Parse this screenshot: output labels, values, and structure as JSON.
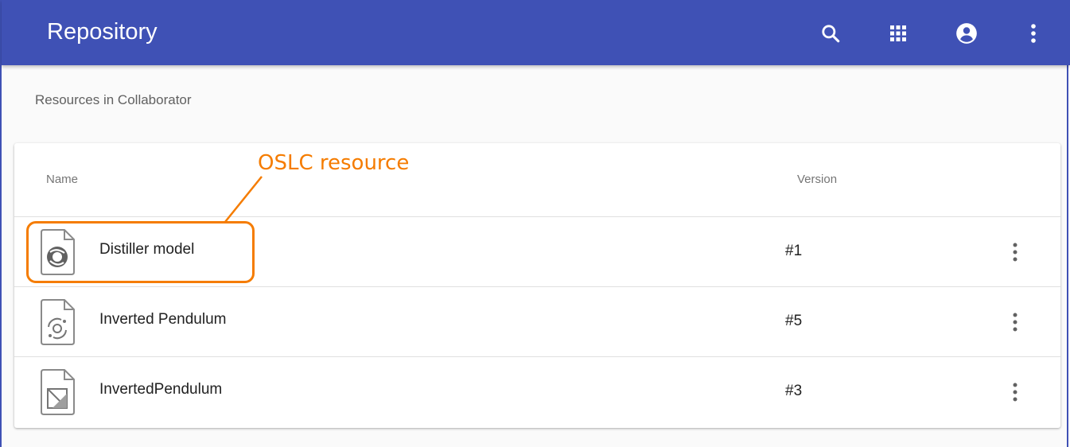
{
  "app": {
    "title": "Repository",
    "colors": {
      "appbar": "#3f51b5",
      "annotation": "#f57c00"
    }
  },
  "toolbar": {
    "icons": [
      "search-icon",
      "apps-grid-icon",
      "account-circle-icon",
      "more-vert-icon"
    ]
  },
  "section": {
    "label": "Resources in Collaborator"
  },
  "table": {
    "columns": {
      "name": "Name",
      "version": "Version"
    },
    "rows": [
      {
        "name": "Distiller model",
        "version": "#1",
        "icon": "model-file-icon"
      },
      {
        "name": "Inverted Pendulum",
        "version": "#5",
        "icon": "simulation-file-icon"
      },
      {
        "name": "InvertedPendulum",
        "version": "#3",
        "icon": "diagram-file-icon"
      }
    ]
  },
  "annotation": {
    "label": "OSLC resource"
  }
}
